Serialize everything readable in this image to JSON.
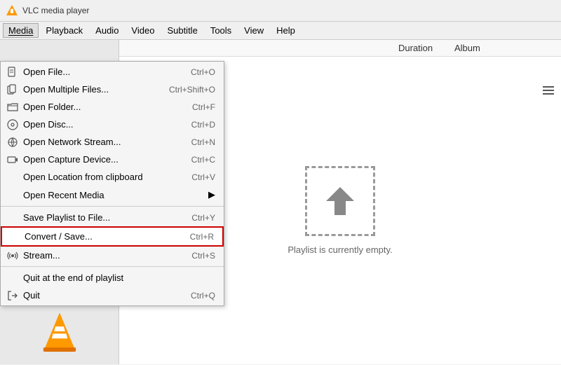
{
  "app": {
    "title": "VLC media player",
    "icon": "vlc-icon"
  },
  "menubar": {
    "items": [
      {
        "id": "media",
        "label": "Media",
        "active": true
      },
      {
        "id": "playback",
        "label": "Playback"
      },
      {
        "id": "audio",
        "label": "Audio"
      },
      {
        "id": "video",
        "label": "Video"
      },
      {
        "id": "subtitle",
        "label": "Subtitle"
      },
      {
        "id": "tools",
        "label": "Tools"
      },
      {
        "id": "view",
        "label": "View"
      },
      {
        "id": "help",
        "label": "Help"
      }
    ]
  },
  "media_menu": {
    "items": [
      {
        "id": "open-file",
        "icon": "file-icon",
        "label": "Open File...",
        "shortcut": "Ctrl+O",
        "separator_after": false
      },
      {
        "id": "open-multiple",
        "icon": "files-icon",
        "label": "Open Multiple Files...",
        "shortcut": "Ctrl+Shift+O",
        "separator_after": false
      },
      {
        "id": "open-folder",
        "icon": "folder-icon",
        "label": "Open Folder...",
        "shortcut": "Ctrl+F",
        "separator_after": false
      },
      {
        "id": "open-disc",
        "icon": "disc-icon",
        "label": "Open Disc...",
        "shortcut": "Ctrl+D",
        "separator_after": false
      },
      {
        "id": "open-network",
        "icon": "network-icon",
        "label": "Open Network Stream...",
        "shortcut": "Ctrl+N",
        "separator_after": false
      },
      {
        "id": "open-capture",
        "icon": "capture-icon",
        "label": "Open Capture Device...",
        "shortcut": "Ctrl+C",
        "separator_after": false
      },
      {
        "id": "open-location",
        "icon": "",
        "label": "Open Location from clipboard",
        "shortcut": "Ctrl+V",
        "separator_after": false
      },
      {
        "id": "open-recent",
        "icon": "",
        "label": "Open Recent Media",
        "shortcut": "",
        "has_arrow": true,
        "separator_after": true
      },
      {
        "id": "save-playlist",
        "icon": "",
        "label": "Save Playlist to File...",
        "shortcut": "Ctrl+Y",
        "separator_after": false
      },
      {
        "id": "convert-save",
        "icon": "",
        "label": "Convert / Save...",
        "shortcut": "Ctrl+R",
        "separator_after": false,
        "highlighted": true
      },
      {
        "id": "stream",
        "icon": "stream-icon",
        "label": "Stream...",
        "shortcut": "Ctrl+S",
        "separator_after": true
      },
      {
        "id": "quit-end",
        "icon": "",
        "label": "Quit at the end of playlist",
        "shortcut": "",
        "separator_after": false
      },
      {
        "id": "quit",
        "icon": "quit-icon",
        "label": "Quit",
        "shortcut": "Ctrl+Q",
        "separator_after": false
      }
    ]
  },
  "playlist": {
    "columns": [
      {
        "id": "title",
        "label": ""
      },
      {
        "id": "duration",
        "label": "Duration"
      },
      {
        "id": "album",
        "label": "Album"
      }
    ],
    "empty_text": "Playlist is currently empty."
  },
  "icons": {
    "file": "📄",
    "folder": "📁",
    "disc": "💿",
    "network": "🌐",
    "capture": "📷",
    "stream": "📡",
    "quit": "🚪",
    "playlist": "≡"
  },
  "colors": {
    "highlight_border": "#cc0000",
    "menu_bg": "#f5f5f5",
    "accent": "#0078d7"
  }
}
